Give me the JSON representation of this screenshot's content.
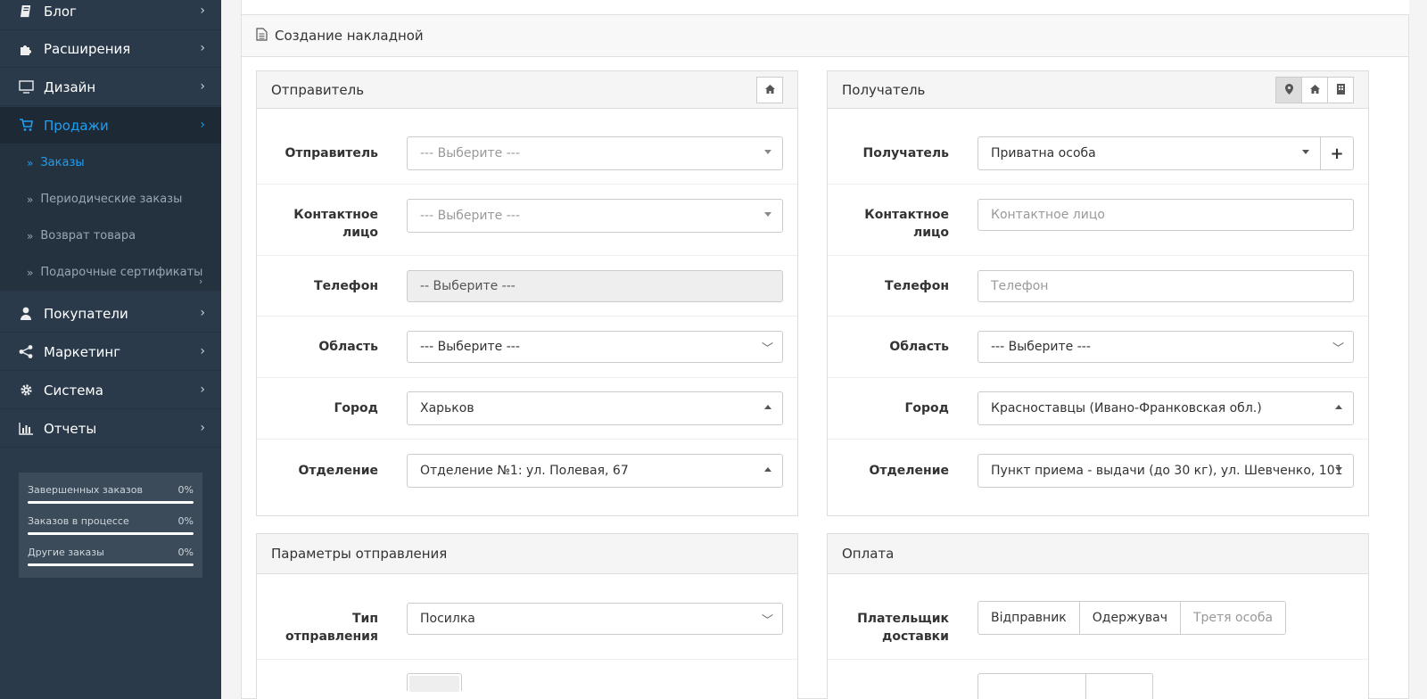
{
  "sidebar": {
    "items": [
      {
        "label": "Блог",
        "icon": "book-icon"
      },
      {
        "label": "Расширения",
        "icon": "puzzle-icon"
      },
      {
        "label": "Дизайн",
        "icon": "monitor-icon"
      },
      {
        "label": "Продажи",
        "icon": "cart-icon"
      },
      {
        "label": "Покупатели",
        "icon": "user-icon"
      },
      {
        "label": "Маркетинг",
        "icon": "share-icon"
      },
      {
        "label": "Система",
        "icon": "gear-icon"
      },
      {
        "label": "Отчеты",
        "icon": "bar-chart-icon"
      }
    ],
    "sub_items": [
      {
        "label": "Заказы"
      },
      {
        "label": "Периодические заказы"
      },
      {
        "label": "Возврат товара"
      },
      {
        "label": "Подарочные сертификаты"
      }
    ],
    "stats": [
      {
        "label": "Завершенных заказов",
        "percent": "0%"
      },
      {
        "label": "Заказов в процессе",
        "percent": "0%"
      },
      {
        "label": "Другие заказы",
        "percent": "0%"
      }
    ]
  },
  "page": {
    "title": "Создание накладной"
  },
  "sender": {
    "title": "Отправитель",
    "fields": {
      "sender": {
        "label": "Отправитель",
        "value": "--- Выберите ---"
      },
      "contact": {
        "label": "Контактное лицо",
        "value": "--- Выберите ---"
      },
      "phone": {
        "label": "Телефон",
        "value": "-- Выберите ---"
      },
      "region": {
        "label": "Область",
        "value": "--- Выберите ---"
      },
      "city": {
        "label": "Город",
        "value": "Харьков"
      },
      "branch": {
        "label": "Отделение",
        "value": "Отделение №1: ул. Полевая, 67"
      }
    }
  },
  "recipient": {
    "title": "Получатель",
    "fields": {
      "recipient": {
        "label": "Получатель",
        "value": "Приватна особа"
      },
      "contact": {
        "label": "Контактное лицо",
        "placeholder": "Контактное лицо"
      },
      "phone": {
        "label": "Телефон",
        "placeholder": "Телефон"
      },
      "region": {
        "label": "Область",
        "value": "--- Выберите ---"
      },
      "city": {
        "label": "Город",
        "value": "Красноставцы (Ивано-Франковская обл.)"
      },
      "branch": {
        "label": "Отделение",
        "value": "Пункт приема - выдачи (до 30 кг), ул. Шевченко, 101"
      }
    }
  },
  "shipment": {
    "title": "Параметры отправления",
    "type_label": "Тип отправления",
    "type_value": "Посилка"
  },
  "payment": {
    "title": "Оплата",
    "payer_label": "Плательщик доставки",
    "payer_options": [
      "Відправник",
      "Одержувач",
      "Третя особа"
    ]
  }
}
